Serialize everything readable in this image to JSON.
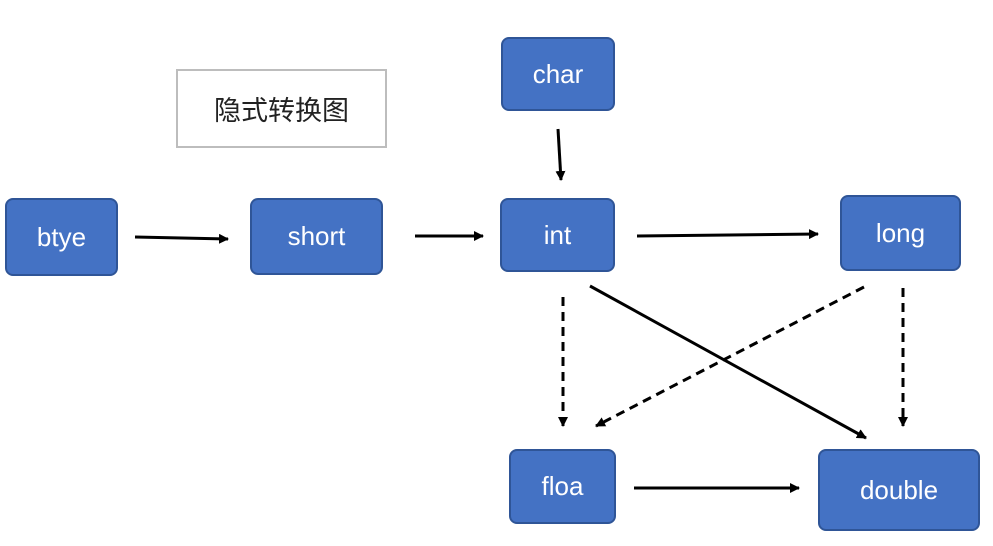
{
  "title": "隐式转换图",
  "node_color": "#4472c4",
  "edge_color": "#000000",
  "nodes": {
    "char": "char",
    "btye": "btye",
    "short": "short",
    "int": "int",
    "long": "long",
    "floa": "floa",
    "double": "double"
  },
  "edges": [
    {
      "from": "char",
      "to": "int",
      "style": "solid"
    },
    {
      "from": "btye",
      "to": "short",
      "style": "solid"
    },
    {
      "from": "short",
      "to": "int",
      "style": "solid"
    },
    {
      "from": "int",
      "to": "long",
      "style": "solid"
    },
    {
      "from": "int",
      "to": "floa",
      "style": "dashed"
    },
    {
      "from": "int",
      "to": "double",
      "style": "solid"
    },
    {
      "from": "long",
      "to": "floa",
      "style": "dashed"
    },
    {
      "from": "long",
      "to": "double",
      "style": "dashed"
    },
    {
      "from": "floa",
      "to": "double",
      "style": "solid"
    }
  ]
}
